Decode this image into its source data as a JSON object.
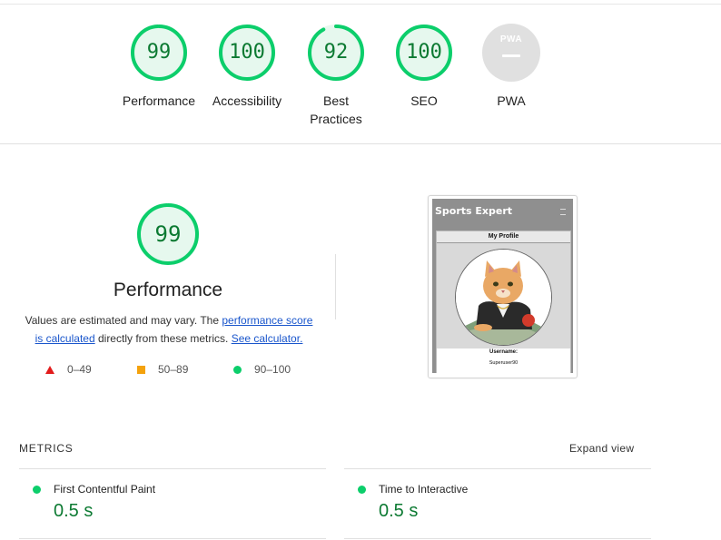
{
  "categories": [
    {
      "label": "Performance",
      "score": "99",
      "fraction": 0.99
    },
    {
      "label": "Accessibility",
      "score": "100",
      "fraction": 1.0
    },
    {
      "label": "Best Practices",
      "score": "92",
      "fraction": 0.92
    },
    {
      "label": "SEO",
      "score": "100",
      "fraction": 1.0
    },
    {
      "label": "PWA",
      "badge": "PWA",
      "score": "—"
    }
  ],
  "performance": {
    "score": "99",
    "fraction": 0.99,
    "title": "Performance",
    "desc_prefix": "Values are estimated and may vary. The ",
    "desc_link1": "performance score is calculated",
    "desc_middle": " directly from these metrics. ",
    "desc_link2": "See calculator."
  },
  "legend": [
    {
      "range": "0–49",
      "shape": "triangle",
      "color": "#e21c1c"
    },
    {
      "range": "50–89",
      "shape": "square",
      "color": "#f4a20c"
    },
    {
      "range": "90–100",
      "shape": "circle",
      "color": "#0cce6b"
    }
  ],
  "screenshot": {
    "app_title": "Sports Expert",
    "card_header": "My Profile",
    "username_label": "Username:",
    "username_value": "Superuser90"
  },
  "metrics": {
    "title": "METRICS",
    "expand_label": "Expand view",
    "items": [
      {
        "name": "First Contentful Paint",
        "value": "0.5 s"
      },
      {
        "name": "Time to Interactive",
        "value": "0.5 s"
      }
    ]
  },
  "colors": {
    "pass": "#0cce6b",
    "pass_text": "#0c7a32",
    "pass_bg": "#e6f8ee",
    "link": "#1a56cc",
    "pwa_gray": "#e0e0e0"
  }
}
